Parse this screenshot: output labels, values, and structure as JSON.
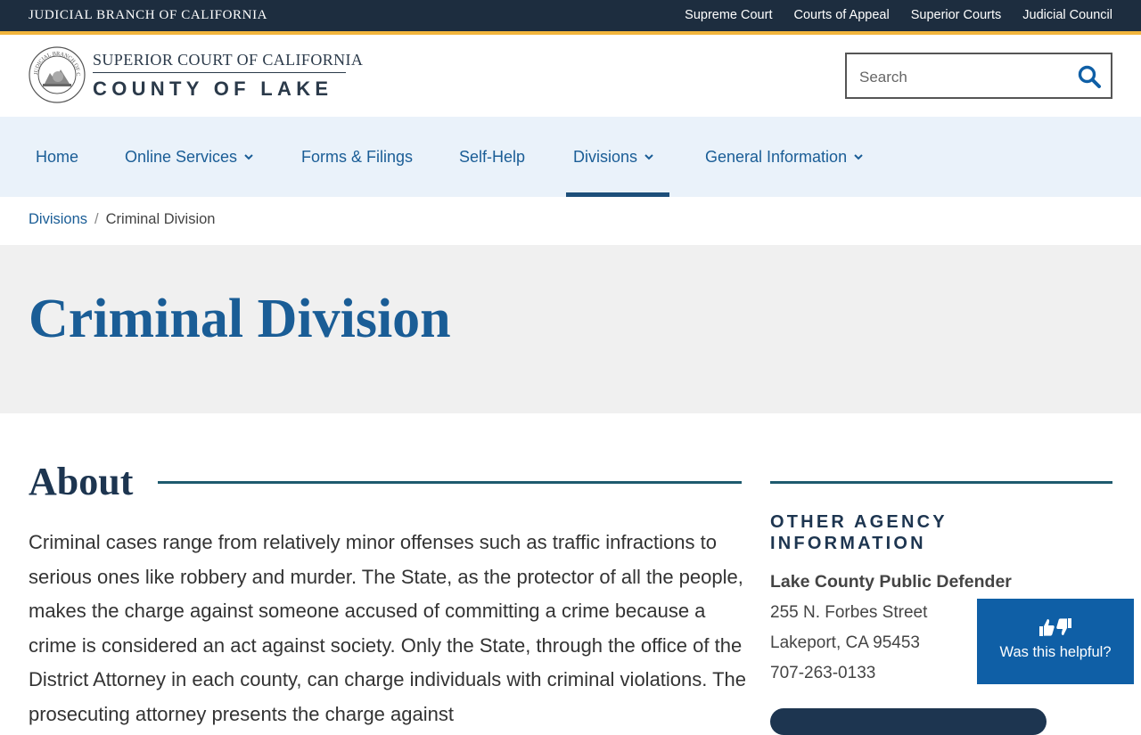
{
  "top_bar": {
    "branch_name": "JUDICIAL BRANCH OF CALIFORNIA",
    "links": [
      "Supreme Court",
      "Courts of Appeal",
      "Superior Courts",
      "Judicial Council"
    ]
  },
  "header": {
    "seal_text": "JUDICIAL BRANCH OF CALIFORNIA",
    "court_line1": "SUPERIOR COURT OF CALIFORNIA",
    "court_line2": "COUNTY OF LAKE",
    "search": {
      "placeholder": "Search",
      "value": ""
    }
  },
  "nav": {
    "items": [
      {
        "label": "Home",
        "has_dropdown": false
      },
      {
        "label": "Online Services",
        "has_dropdown": true
      },
      {
        "label": "Forms & Filings",
        "has_dropdown": false
      },
      {
        "label": "Self-Help",
        "has_dropdown": false
      },
      {
        "label": "Divisions",
        "has_dropdown": true,
        "active": true
      },
      {
        "label": "General Information",
        "has_dropdown": true
      }
    ]
  },
  "breadcrumb": {
    "parent": "Divisions",
    "separator": "/",
    "current": "Criminal Division"
  },
  "page_title": "Criminal Division",
  "about": {
    "heading": "About",
    "paragraph": "Criminal cases range from relatively minor offenses such as traffic infractions to serious ones like robbery and murder. The State, as the protector of all the people, makes the charge against someone accused of committing a crime because a crime is considered an act against society. Only the State, through the office of the District Attorney in each county, can charge individuals with criminal violations.  The prosecuting attorney presents the charge against"
  },
  "sidebar": {
    "heading": "OTHER AGENCY INFORMATION",
    "agency": {
      "name": "Lake County Public Defender",
      "street": "255 N. Forbes Street",
      "city": "Lakeport, CA 95453",
      "phone": "707-263-0133"
    }
  },
  "feedback": {
    "label": "Was this helpful?",
    "icon": "thumbs-up-down-icon"
  },
  "colors": {
    "top_bar": "#1d2d3f",
    "accent_gold": "#f2b53c",
    "link_blue": "#1a5d96",
    "nav_bg": "#eaf2fa",
    "hero_bg": "#f0f0f0",
    "feedback_bg": "#0f5fa6"
  }
}
